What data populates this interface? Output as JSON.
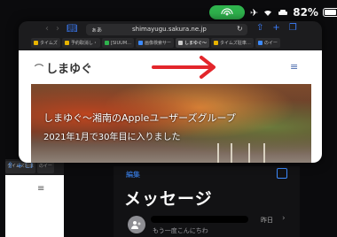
{
  "status": {
    "battery_percent": "82%",
    "battery_level": 0.82
  },
  "safari": {
    "address_prefix": "ぁあ",
    "url": "shimayugu.sakura.ne.jp",
    "tabs": [
      {
        "label": "タイムズ",
        "color": "#e8b400"
      },
      {
        "label": "予約取消し・",
        "color": "#e8b400"
      },
      {
        "label": "[SIUUM...",
        "color": "#2fb34d"
      },
      {
        "label": "画像検索サー",
        "color": "#3d8bff"
      },
      {
        "label": "しまゆぐ〜",
        "color": "#cccccc"
      },
      {
        "label": "タイムズ駐車…",
        "color": "#e8b400"
      },
      {
        "label": "のイー",
        "color": "#3d8bff"
      }
    ],
    "site_logo": "しまゆぐ",
    "hero_title": "しまゆぐ〜湘南のAppleユーザーズグループ",
    "hero_subtitle": "2021年1月で30年目に入りました"
  },
  "messages": {
    "edit_label": "編集",
    "title": "メッセージ",
    "row_date": "昨日",
    "row_preview": "もう一度こんにちわ"
  },
  "background_tabs": [
    "タイムズ駐車",
    "のイー"
  ],
  "colors": {
    "accent": "#3d8bff",
    "hotspot": "#2fb34d",
    "arrow": "#e3262b"
  }
}
